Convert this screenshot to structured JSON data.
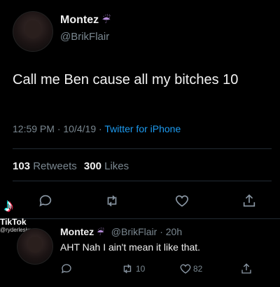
{
  "tweet": {
    "author_name": "Montez",
    "author_emoji": "☔",
    "handle": "@BrikFlair",
    "text": "Call me Ben cause all my bitches 10",
    "time": "12:59 PM",
    "date": "10/4/19",
    "source": "Twitter for iPhone",
    "sep": "·",
    "retweets_count": "103",
    "retweets_label": "Retweets",
    "likes_count": "300",
    "likes_label": "Likes"
  },
  "reply": {
    "author_name": "Montez",
    "author_emoji": "☔",
    "handle": "@BrikFlair",
    "age": "20h",
    "sep": "·",
    "text": "AHT Nah I ain't mean it like that.",
    "retweets": "10",
    "likes": "82"
  },
  "watermark": {
    "logo": "♪",
    "brand": "TikTok",
    "user": "@ryderlesiw"
  },
  "icons": {
    "reply": "comment-icon",
    "retweet": "retweet-icon",
    "like": "heart-icon",
    "share": "share-icon"
  },
  "colors": {
    "background": "#000000",
    "accent": "#1d9bf0",
    "muted": "#7a8790"
  }
}
